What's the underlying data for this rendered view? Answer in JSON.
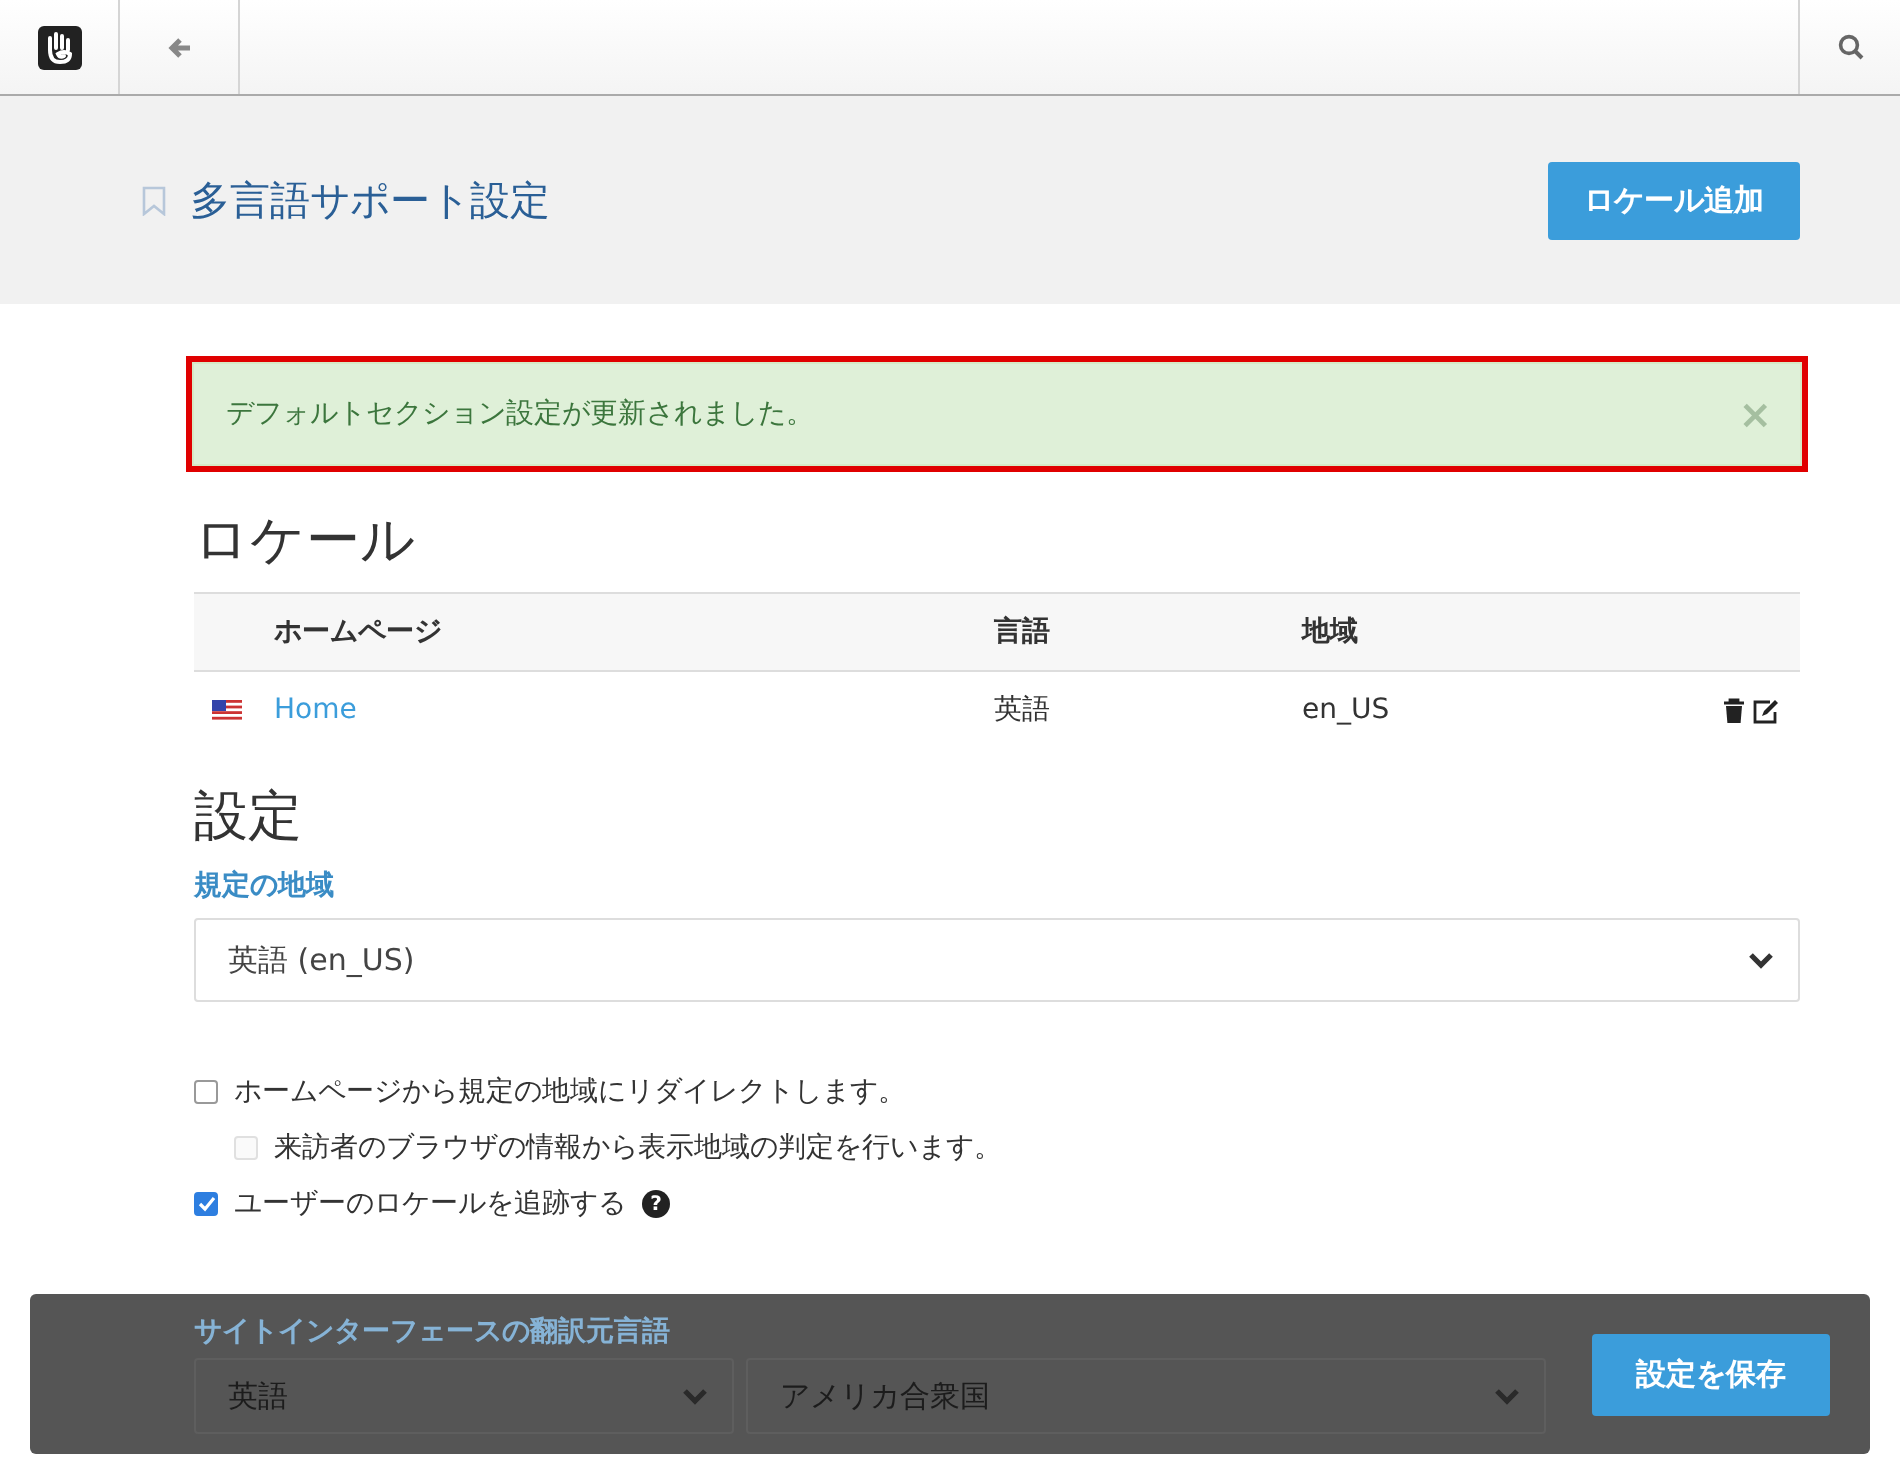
{
  "header": {
    "title": "多言語サポート設定",
    "add_button": "ロケール追加"
  },
  "alert": {
    "message": "デフォルトセクション設定が更新されました。",
    "close": "×",
    "highlighted": true
  },
  "locales": {
    "heading": "ロケール",
    "columns": [
      "ホームページ",
      "言語",
      "地域"
    ],
    "rows": [
      {
        "home": "Home",
        "language": "英語",
        "region": "en_US"
      }
    ]
  },
  "settings": {
    "heading": "設定",
    "default_label": "規定の地域",
    "default_value": "英語 (en_US)",
    "options": [
      {
        "label": "ホームページから規定の地域にリダイレクトします。",
        "checked": false,
        "disabled": false,
        "children": [
          {
            "label": "来訪者のブラウザの情報から表示地域の判定を行います。",
            "checked": false,
            "disabled": true
          }
        ]
      },
      {
        "label": "ユーザーのロケールを追跡する",
        "checked": true,
        "disabled": false,
        "help": "?"
      }
    ],
    "source_label": "サイトインターフェースの翻訳元言語",
    "source_language": "英語",
    "source_country": "アメリカ合衆国"
  },
  "footer": {
    "save_button": "設定を保存"
  }
}
